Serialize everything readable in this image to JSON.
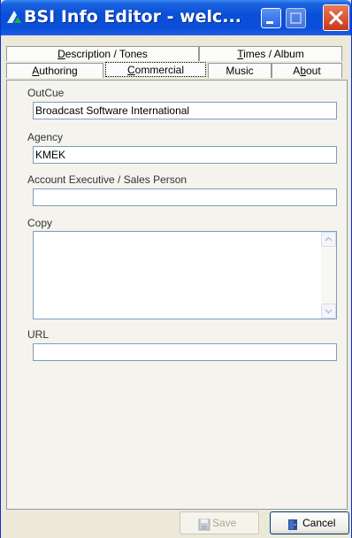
{
  "window": {
    "title": "BSI Info Editor - welc..."
  },
  "tabs": {
    "row1": [
      {
        "label": "Description / Tones",
        "mnemonic": "D",
        "rest": "escription / Tones"
      },
      {
        "label": "Times / Album",
        "mnemonic": "T",
        "rest": "imes / Album"
      }
    ],
    "row2": [
      {
        "label": "Authoring",
        "mnemonic": "A",
        "rest": "uthoring"
      },
      {
        "label": "Commercial",
        "mnemonic": "C",
        "rest": "ommercial"
      },
      {
        "label": "Music",
        "pre": "Music"
      },
      {
        "label": "About",
        "pre": "A",
        "mnemonic": "b",
        "rest": "out"
      }
    ],
    "selected": "Commercial"
  },
  "form": {
    "outcue": {
      "label": "OutCue",
      "value": "Broadcast Software International"
    },
    "agency": {
      "label": "Agency",
      "value": "KMEK"
    },
    "account_exec": {
      "label": "Account Executive / Sales Person",
      "value": ""
    },
    "copy": {
      "label": "Copy",
      "value": ""
    },
    "url": {
      "label": "URL",
      "value": ""
    }
  },
  "buttons": {
    "save": {
      "label": "Save",
      "enabled": false,
      "icon": "floppy-disk-icon"
    },
    "cancel": {
      "label": "Cancel",
      "enabled": true,
      "icon": "door-icon"
    }
  },
  "colors": {
    "titlebar": "#0a4fd6",
    "window_bg": "#ece9d8",
    "close_button": "#c8381a"
  }
}
